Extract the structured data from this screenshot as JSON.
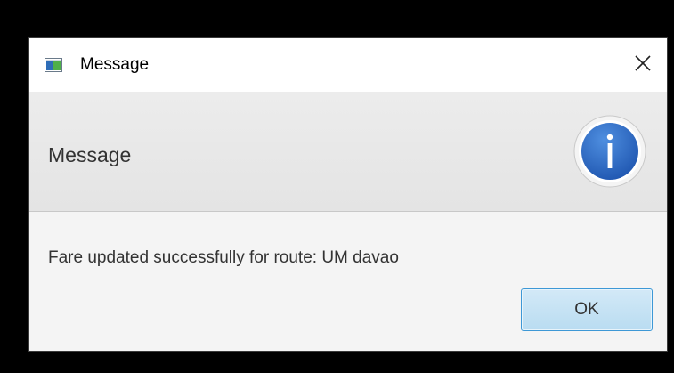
{
  "window": {
    "title": "Message",
    "app_icon": "window-app-icon",
    "close_icon": "close-icon"
  },
  "header": {
    "text": "Message",
    "icon": "info-icon",
    "icon_glyph": "i",
    "icon_color": "#2a6bc8"
  },
  "content": {
    "message": "Fare updated successfully for route: UM davao"
  },
  "buttons": {
    "ok_label": "OK"
  },
  "colors": {
    "accent": "#3d98d6",
    "ok_button_fill": "#c6e3f5"
  }
}
